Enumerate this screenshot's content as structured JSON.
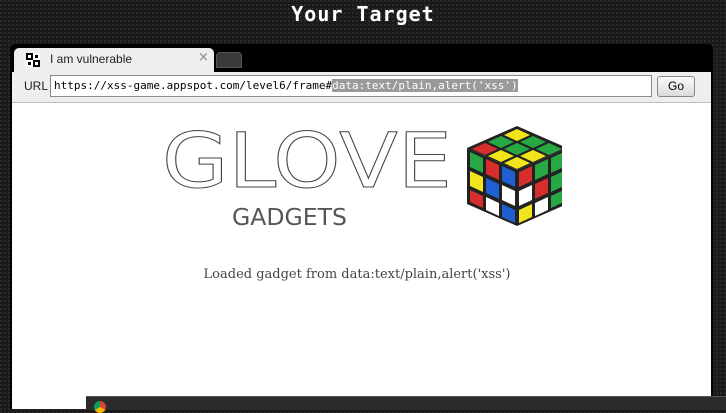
{
  "page": {
    "heading": "Your Target"
  },
  "browser": {
    "tab": {
      "title": "I am vulnerable",
      "close_glyph": "×"
    },
    "toolbar": {
      "url_label": "URL",
      "url_prefix": "https://xss-game.appspot.com/level6/frame#",
      "url_selected": "data:text/plain,alert('xss')",
      "go_label": "Go"
    },
    "content": {
      "logo_main": "GLOVE",
      "logo_sub": "GADGETS",
      "loaded_text": "Loaded gadget from data:text/plain,alert('xss')"
    }
  },
  "icons": {
    "favicon": "checker-favicon-icon",
    "logo_cube": "rubiks-cube-icon",
    "taskbar": "chrome-icon"
  },
  "colors": {
    "background": "#1a1a1a",
    "selection": "#9a9a9a",
    "toolbar": "#eeeeee"
  }
}
